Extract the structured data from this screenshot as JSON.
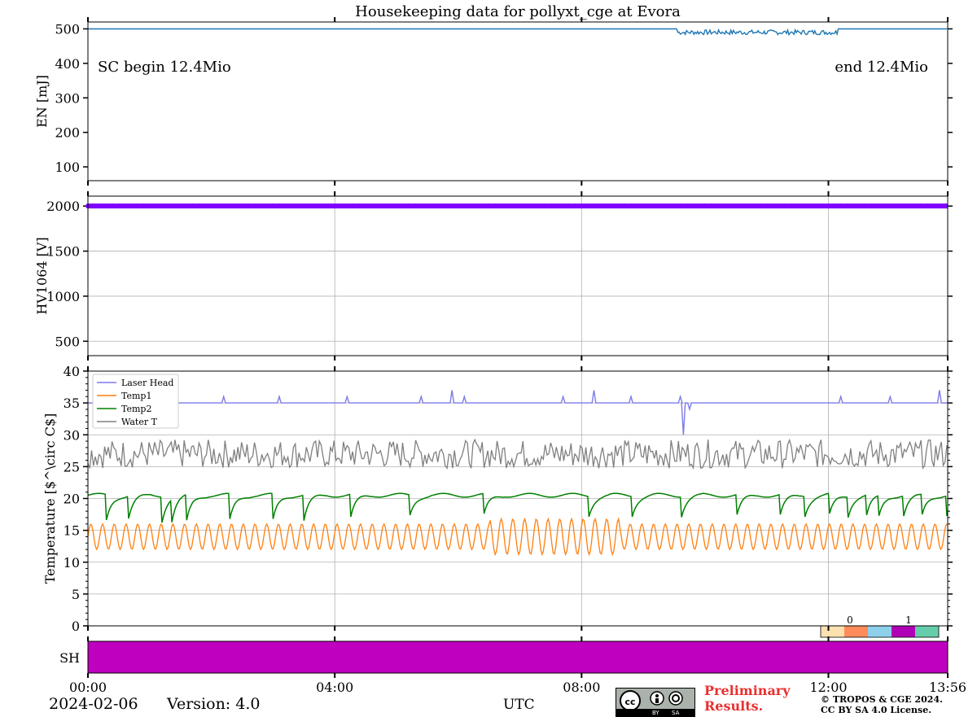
{
  "title": "Housekeeping data for pollyxt_cge at Evora",
  "footer": {
    "date": "2024-02-06",
    "version": "Version: 4.0",
    "xlabel": "UTC",
    "preliminary_line1": "Preliminary",
    "preliminary_line2": "Results.",
    "copyright_line1": "© TROPOS & CGE 2024.",
    "copyright_line2": "CC BY SA 4.0 License.",
    "cc_badge": [
      "cc",
      "BY",
      "SA"
    ]
  },
  "chart_data": [
    {
      "type": "line",
      "panel": "energy",
      "ylabel": "EN [mJ]",
      "yticks": [
        100,
        200,
        300,
        400,
        500
      ],
      "ylim": [
        60,
        520
      ],
      "xlim": [
        0,
        13.933
      ],
      "xticks": [
        "00:00",
        "04:00",
        "08:00",
        "12:00",
        "13:56"
      ],
      "grid": false,
      "color": "#1f77b4",
      "annotations": [
        "SC begin 12.4Mio",
        "end 12.4Mio"
      ],
      "series": [
        {
          "x": [
            0,
            1.5,
            1.9,
            2.4,
            5,
            9.5,
            9.6,
            9.8,
            10,
            10.3,
            10.6,
            10.9,
            11.2,
            11.5,
            11.8,
            12.1,
            12.2,
            13.933
          ],
          "values": [
            500,
            500,
            500,
            500,
            500,
            500,
            493,
            487,
            495,
            488,
            492,
            486,
            494,
            488,
            491,
            493,
            500,
            500
          ]
        }
      ]
    },
    {
      "type": "scatter",
      "panel": "hv1064",
      "ylabel": "HV1064 [V]",
      "yticks": [
        500,
        1000,
        1500,
        2000
      ],
      "ylim": [
        340,
        2110
      ],
      "xlim": [
        0,
        13.933
      ],
      "grid": true,
      "color": "#7f00ff",
      "series": [
        {
          "x_range": [
            0,
            13.933
          ],
          "values": [
            2000
          ]
        }
      ]
    },
    {
      "type": "line",
      "panel": "temperature",
      "ylabel": "Temperature [$^\\circ C$]",
      "yticks": [
        0,
        5,
        10,
        15,
        20,
        25,
        30,
        35,
        40
      ],
      "ylim": [
        0,
        40
      ],
      "xlim": [
        0,
        13.933
      ],
      "grid": true,
      "legend": "upper-left",
      "series": [
        {
          "name": "Laser Head",
          "color": "#7b7bea",
          "baseline": 35,
          "x": [
            0.5,
            0.8,
            1.2,
            2.2,
            3.1,
            4.2,
            5.4,
            5.9,
            6.1,
            7.7,
            8.2,
            8.8,
            9.6,
            9.65,
            9.75,
            12.2,
            13.0,
            13.8
          ],
          "values": [
            36,
            36,
            36,
            36,
            36,
            36,
            36,
            37,
            36,
            36,
            37,
            36,
            36,
            30,
            34,
            36,
            36,
            37
          ]
        },
        {
          "name": "Temp1",
          "color": "#ff7f0e",
          "mean": 14,
          "amplitude": 2,
          "min": 11,
          "max": 16
        },
        {
          "name": "Temp2",
          "color": "#008000",
          "mean": 20.5,
          "dip_min": 16.5,
          "max": 21
        },
        {
          "name": "Water T",
          "color": "#808080",
          "mean": 27,
          "min": 24,
          "max": 30
        }
      ]
    },
    {
      "type": "heatmap",
      "panel": "shutter",
      "ylabel": "SH",
      "xlim": [
        0,
        13.933
      ],
      "color": "#bf00bf",
      "values": [
        1
      ]
    }
  ],
  "colorbar": {
    "ticks": [
      "0",
      "1"
    ],
    "colors": [
      "#fde0b0",
      "#ff8c5a",
      "#8ed0ec",
      "#b000b5",
      "#66cdaa"
    ]
  }
}
